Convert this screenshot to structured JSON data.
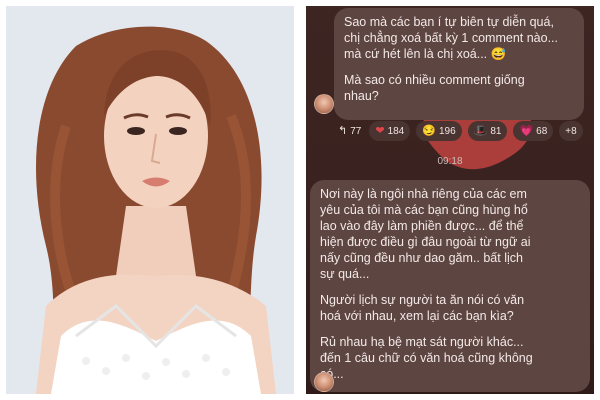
{
  "chat": {
    "message1": [
      "Sao mà các bạn í tự biên tự diễn quá,",
      "chị chẳng xoá bất kỳ 1 comment nào...",
      "mà cứ hét lên là chị xoá... 😅",
      "",
      "Mà sao có nhiều comment giống",
      "nhau?"
    ],
    "reactions": [
      {
        "icon": "reply-arrow-icon",
        "glyph": "↰",
        "count": "77"
      },
      {
        "icon": "heart-icon",
        "glyph": "❤",
        "count": "184"
      },
      {
        "icon": "smirk-face-icon",
        "glyph": "😏",
        "count": "196"
      },
      {
        "icon": "hat-icon",
        "glyph": "🎩",
        "count": "81"
      },
      {
        "icon": "pink-heart-icon",
        "glyph": "💗",
        "count": "68"
      },
      {
        "icon": "more",
        "glyph": "",
        "count": "+8"
      }
    ],
    "timestamp": "09:18",
    "message2": [
      "Nơi này là ngôi nhà riêng của các em",
      "yêu của tôi mà các bạn cũng hùng hổ",
      "lao vào đây làm phiền được... để thể",
      "hiện được điều gì đâu ngoài từ ngữ ai",
      "nấy cũng đều như dao găm.. bất lịch",
      "sự quá...",
      "",
      "Người lịch sự người ta ăn nói có văn",
      "hoá với nhau, xem lại các bạn kìa?",
      "",
      "Rủ nhau hạ bệ mạt sát người khác...",
      "đến 1 câu chữ có văn hoá cũng không",
      "có..."
    ]
  },
  "colors": {
    "chat_background": "#3a2220",
    "bubble": "#5d4542",
    "ribbon": "#c0433f",
    "text": "#f3e9e7"
  }
}
